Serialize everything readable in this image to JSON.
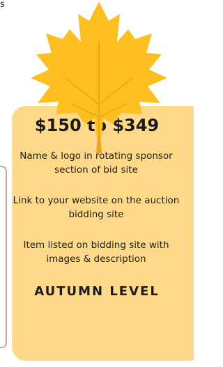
{
  "fragment": {
    "text": "s"
  },
  "card": {
    "price": "$150 to $349",
    "benefits": [
      "Name & logo in rotating sponsor section of bid site",
      "Link to your website on the auction bidding site",
      "Item listed on bidding site with images & description"
    ],
    "level": "AUTUMN LEVEL"
  },
  "colors": {
    "leaf": "#fdbe1f",
    "leaf_vein": "#e8a818",
    "card_bg": "#fed98a",
    "left_card_border": "#c6a88b"
  },
  "icons": {
    "leaf": "maple-leaf-icon"
  }
}
